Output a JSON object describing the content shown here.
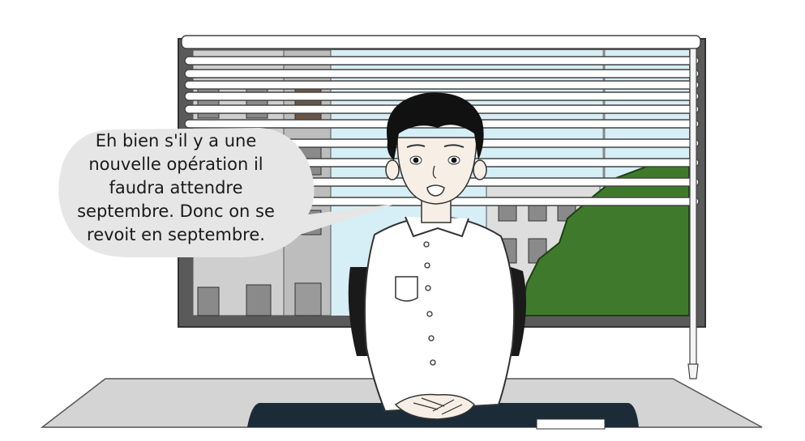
{
  "speech_bubble": {
    "lines": [
      "Eh bien s'il y a une",
      "nouvelle opération il",
      "faudra attendre",
      "septembre. Donc on se",
      "revoit en septembre."
    ]
  },
  "colors": {
    "sky": "#d6eef6",
    "building_light": "#cfcfcf",
    "building_dark": "#a9a9a9",
    "tree": "#3f7a2c",
    "window_frame": "#555555",
    "desk_top": "#d4d4d4",
    "desk_mat": "#1c2b38",
    "speech_bubble": "#e6e6e6"
  }
}
